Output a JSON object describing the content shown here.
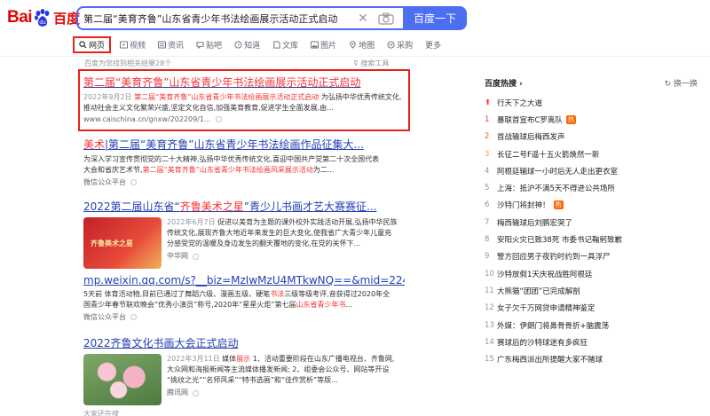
{
  "header": {
    "logo_left": "Bai",
    "logo_right": "百度",
    "query": "第二届“美育齐鲁”山东省青少年书法绘画展示活动正式启动",
    "search_button": "百度一下"
  },
  "tabs": [
    {
      "label": "网页",
      "icon": "search-icon"
    },
    {
      "label": "视频",
      "icon": "video-icon"
    },
    {
      "label": "资讯",
      "icon": "news-icon"
    },
    {
      "label": "贴吧",
      "icon": "tieba-icon"
    },
    {
      "label": "知道",
      "icon": "zhidao-icon"
    },
    {
      "label": "文库",
      "icon": "wenku-icon"
    },
    {
      "label": "图片",
      "icon": "image-icon"
    },
    {
      "label": "地图",
      "icon": "map-icon"
    },
    {
      "label": "采购",
      "icon": "purchase-icon"
    },
    {
      "label": "更多",
      "icon": ""
    }
  ],
  "found_text": "百度为您找到相关结果28个",
  "tools_text": "搜索工具",
  "results": [
    {
      "title": "第二届“美育齐鲁”山东省青少年书法绘画展示活动正式启动",
      "date": "2022年9月2日",
      "snippet_hl": "第二届“美育齐鲁”山东省青少年书法绘画展示活动正式启动",
      "snippet_rest": " 为弘扬中华优秀传统文化,推动社会主义文化繁荣兴盛,坚定文化自信,加强美育教育,促进学生全面发展,由...",
      "source": "www.caischina.cn/gnxw/202209/1..."
    },
    {
      "title_a": "美术",
      "title_b": "|第二届“美育齐鲁”山东省青少年书法绘画作品征集大...",
      "line1": "为深入学习宣传贯彻党的二十大精神,弘扬中华优秀传统文化,喜迎中国共产党第二十次全国代表",
      "line2_a": "大会和省庆艺术节,",
      "line2_hl": "第二届“美育齐鲁”山东省青少年书法绘画风采展示活动",
      "line2_b": "为二...",
      "source": "微信公众平台"
    },
    {
      "title_a": "2022第二届山东省“",
      "title_hl": "齐鲁美术之星",
      "title_b": "”青少儿书画才艺大赛赛征...",
      "date": "2022年6月7日",
      "line1": " 促进以美育为主题的课外校外实践活动开展,弘扬中华民族",
      "line2": "传统文化,展现齐鲁大地近年来发生的巨大变化,使我省广大青少年儿童充",
      "line3": "分感受党的温暖及身边发生的翻天覆地的变化,在党的关怀下...",
      "source": "中华网",
      "thumb_text": "齐鲁美术之星"
    },
    {
      "title": "mp.weixin.qq.com/s?__biz=MzIwMzU4MTkwNQ==&mid=22475422...",
      "line1_a": "5天前 体育活动物,目前已通过了舞蹈六级、漫画五级、硬笔",
      "line1_hl": "书法",
      "line1_b": "三级等级考评,音获得过2020年全",
      "line2_a": "国青少年春节联欢晚会“优秀小演员”称号,2020年“星星火炬”第七届",
      "line2_hl": "山东省青少年书",
      "line2_b": "...",
      "source": "微信公众平台"
    },
    {
      "title": "2022齐鲁文化书画大会正式启动",
      "date": "2022年3月11日",
      "line1_a": " 媒体",
      "line1_hl": "展示",
      "line1_b": " 1、活动重要阶段在山东广播电视台、齐鲁网,",
      "line2": "大众网和海报新闻等主流媒体播发新闻; 2、组委会公众号、网站等开设",
      "line3": "“挑纹之光”“名师风采”“特书选画”和“佳作赏析”等版...",
      "source": "腾讯网"
    }
  ],
  "hot": {
    "title": "百度热搜",
    "refresh": "换一换",
    "items": [
      {
        "num": "",
        "text": "行天下之大道",
        "badge": ""
      },
      {
        "num": "1",
        "text": "暴联首宣布C罗离队",
        "badge": "热"
      },
      {
        "num": "2",
        "text": "首战输球后梅西发声",
        "badge": ""
      },
      {
        "num": "3",
        "text": "长征二号F遥十五火箭焕然一新",
        "badge": ""
      },
      {
        "num": "4",
        "text": "阿根廷输球一小时后无人走出更衣室",
        "badge": ""
      },
      {
        "num": "5",
        "text": "上海：抵沪不满5天不得进公共场所",
        "badge": ""
      },
      {
        "num": "6",
        "text": "沙特门将封神！",
        "badge": "热"
      },
      {
        "num": "7",
        "text": "梅西输球后刘鹏宏哭了",
        "badge": ""
      },
      {
        "num": "8",
        "text": "安阳火灾已致38死 市委书记鞠躬致歉",
        "badge": ""
      },
      {
        "num": "9",
        "text": "警方回应男子夜钓时约到一具浮尸",
        "badge": ""
      },
      {
        "num": "10",
        "text": "沙特放假1天庆祝战胜阿根廷",
        "badge": ""
      },
      {
        "num": "11",
        "text": "大熊猫“团团”已完成解剖",
        "badge": ""
      },
      {
        "num": "12",
        "text": "女子欠千万网贷申请精神鉴定",
        "badge": ""
      },
      {
        "num": "13",
        "text": "外媒：伊朗门将鼻骨骨折+脑震荡",
        "badge": ""
      },
      {
        "num": "14",
        "text": "赛球后的沙特球迷有多疯狂",
        "badge": ""
      },
      {
        "num": "15",
        "text": "广东梅西派出所提醒大家不赌球",
        "badge": ""
      }
    ]
  },
  "more_below": "大家还在搜",
  "colors": {
    "accent": "#4e6ef2",
    "highlight": "#f73131",
    "link": "#2440b3",
    "redbox": "#e8211a"
  }
}
